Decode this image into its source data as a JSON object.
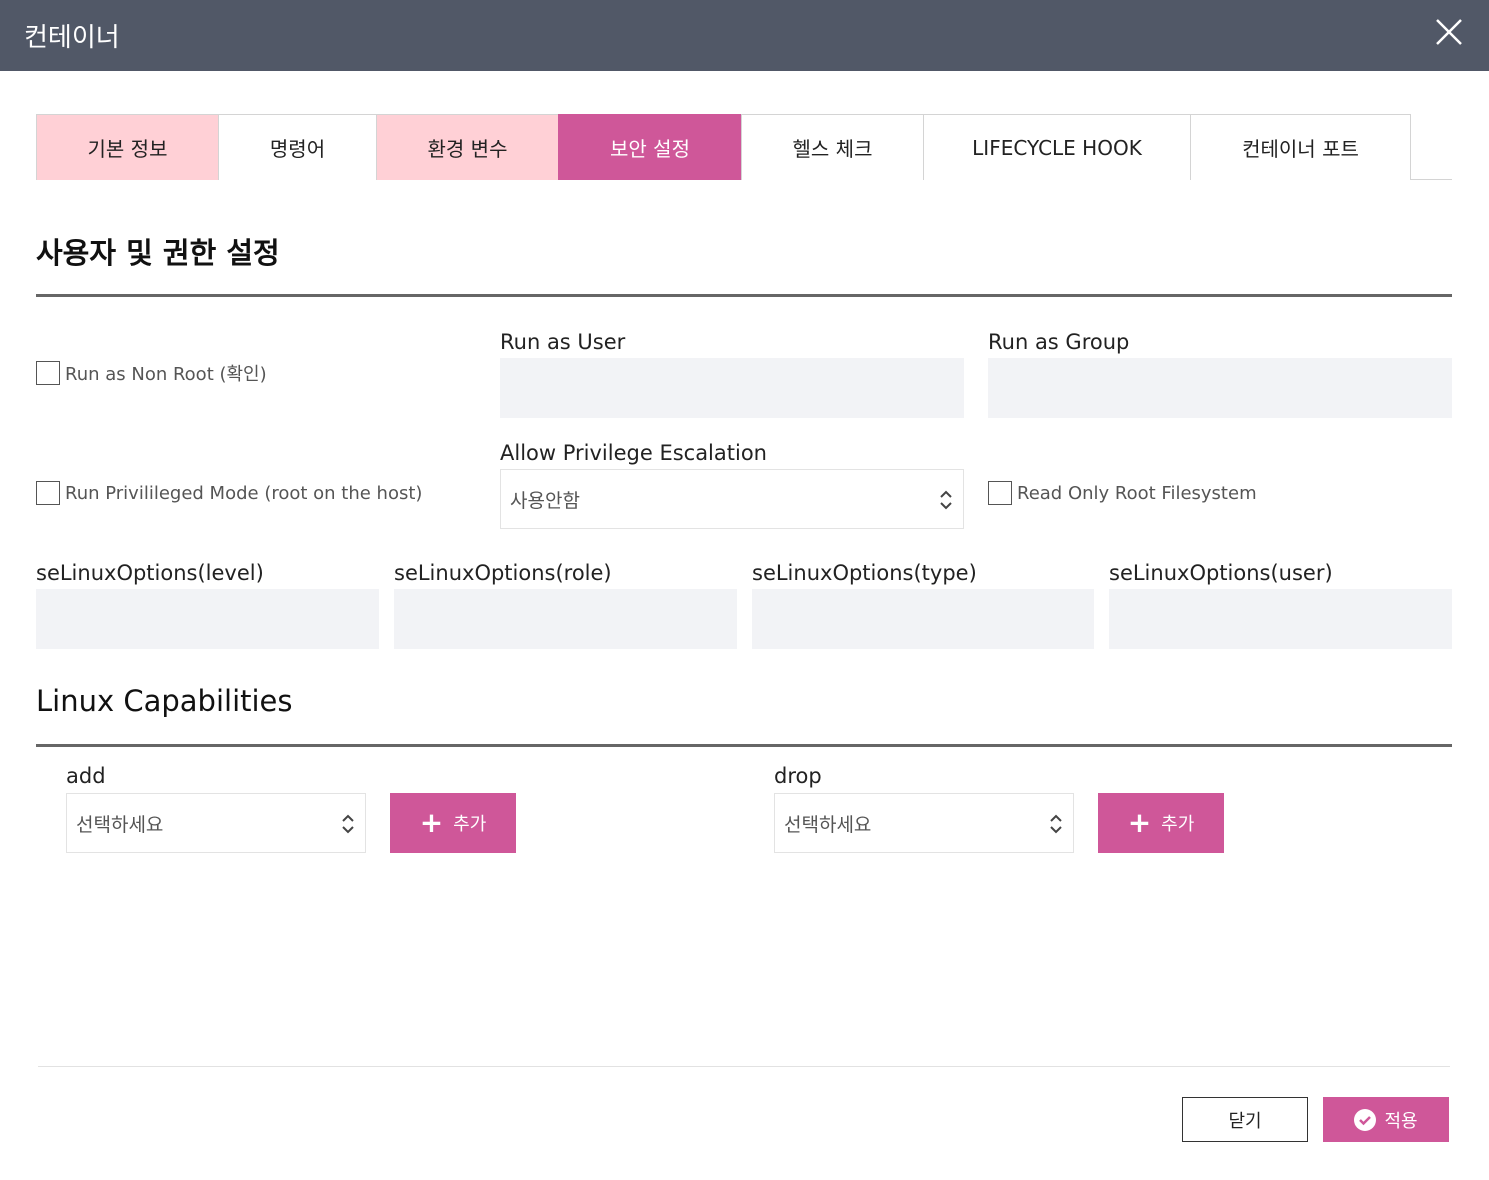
{
  "window": {
    "title": "컨테이너",
    "close_icon": "close-icon"
  },
  "tabs": [
    {
      "label": "기본 정보",
      "state": "visited"
    },
    {
      "label": "명령어",
      "state": "normal"
    },
    {
      "label": "환경 변수",
      "state": "visited"
    },
    {
      "label": "보안 설정",
      "state": "active"
    },
    {
      "label": "헬스 체크",
      "state": "normal"
    },
    {
      "label": "LIFECYCLE HOOK",
      "state": "normal"
    },
    {
      "label": "컨테이너 포트",
      "state": "normal"
    }
  ],
  "user_section": {
    "title": "사용자 및 권한 설정",
    "run_as_non_root": {
      "label": "Run as Non Root (확인)",
      "checked": false
    },
    "run_as_user": {
      "label": "Run as User",
      "value": ""
    },
    "run_as_group": {
      "label": "Run as Group",
      "value": ""
    },
    "run_privileged": {
      "label": "Run Privilileged Mode (root on the host)",
      "checked": false
    },
    "allow_privilege_escalation": {
      "label": "Allow Privilege Escalation",
      "value": "사용안함"
    },
    "read_only_root_fs": {
      "label": "Read Only Root Filesystem",
      "checked": false
    },
    "selinux_level": {
      "label": "seLinuxOptions(level)",
      "value": ""
    },
    "selinux_role": {
      "label": "seLinuxOptions(role)",
      "value": ""
    },
    "selinux_type": {
      "label": "seLinuxOptions(type)",
      "value": ""
    },
    "selinux_user": {
      "label": "seLinuxOptions(user)",
      "value": ""
    }
  },
  "capabilities_section": {
    "title": "Linux Capabilities",
    "add": {
      "label": "add",
      "select_value": "선택하세요",
      "button_label": "추가"
    },
    "drop": {
      "label": "drop",
      "select_value": "선택하세요",
      "button_label": "추가"
    }
  },
  "footer": {
    "close_label": "닫기",
    "apply_label": "적용"
  },
  "colors": {
    "titlebar": "#515867",
    "accent": "#cf5799",
    "visited_tab": "#ffd0d6",
    "input_bg": "#f2f3f6"
  }
}
